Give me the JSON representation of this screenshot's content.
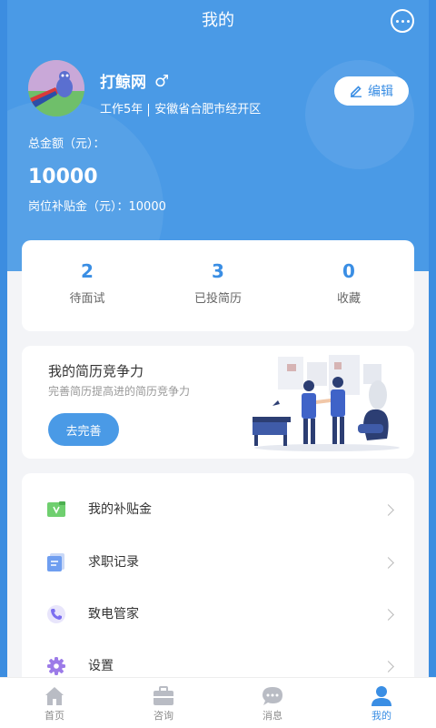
{
  "header": {
    "title": "我的",
    "chat_icon": "more-dots-icon"
  },
  "profile": {
    "name": "打鲸网",
    "gender_symbol": "♂",
    "experience": "工作5年",
    "location": "安徽省合肥市经开区",
    "edit_label": "编辑"
  },
  "finance": {
    "total_label": "总金额（元）：",
    "total_value": "10000",
    "subsidy_line": "岗位补贴金（元）：10000"
  },
  "stats": [
    {
      "value": "2",
      "label": "待面试"
    },
    {
      "value": "3",
      "label": "已投简历"
    },
    {
      "value": "0",
      "label": "收藏"
    }
  ],
  "resume": {
    "title": "我的简历竞争力",
    "subtitle": "完善简历提高进的简历竞争力",
    "button_label": "去完善"
  },
  "menu": [
    {
      "label": "我的补贴金",
      "icon": "wallet-icon"
    },
    {
      "label": "求职记录",
      "icon": "document-icon"
    },
    {
      "label": "致电管家",
      "icon": "phone-icon"
    },
    {
      "label": "设置",
      "icon": "gear-icon"
    }
  ],
  "tabs": [
    {
      "label": "首页",
      "icon": "home-icon",
      "active": false
    },
    {
      "label": "咨询",
      "icon": "briefcase-icon",
      "active": false
    },
    {
      "label": "消息",
      "icon": "message-icon",
      "active": false
    },
    {
      "label": "我的",
      "icon": "user-icon",
      "active": true
    }
  ],
  "colors": {
    "primary": "#4a9ae6",
    "accent": "#3a8ee4",
    "background": "#f3f4f7"
  }
}
